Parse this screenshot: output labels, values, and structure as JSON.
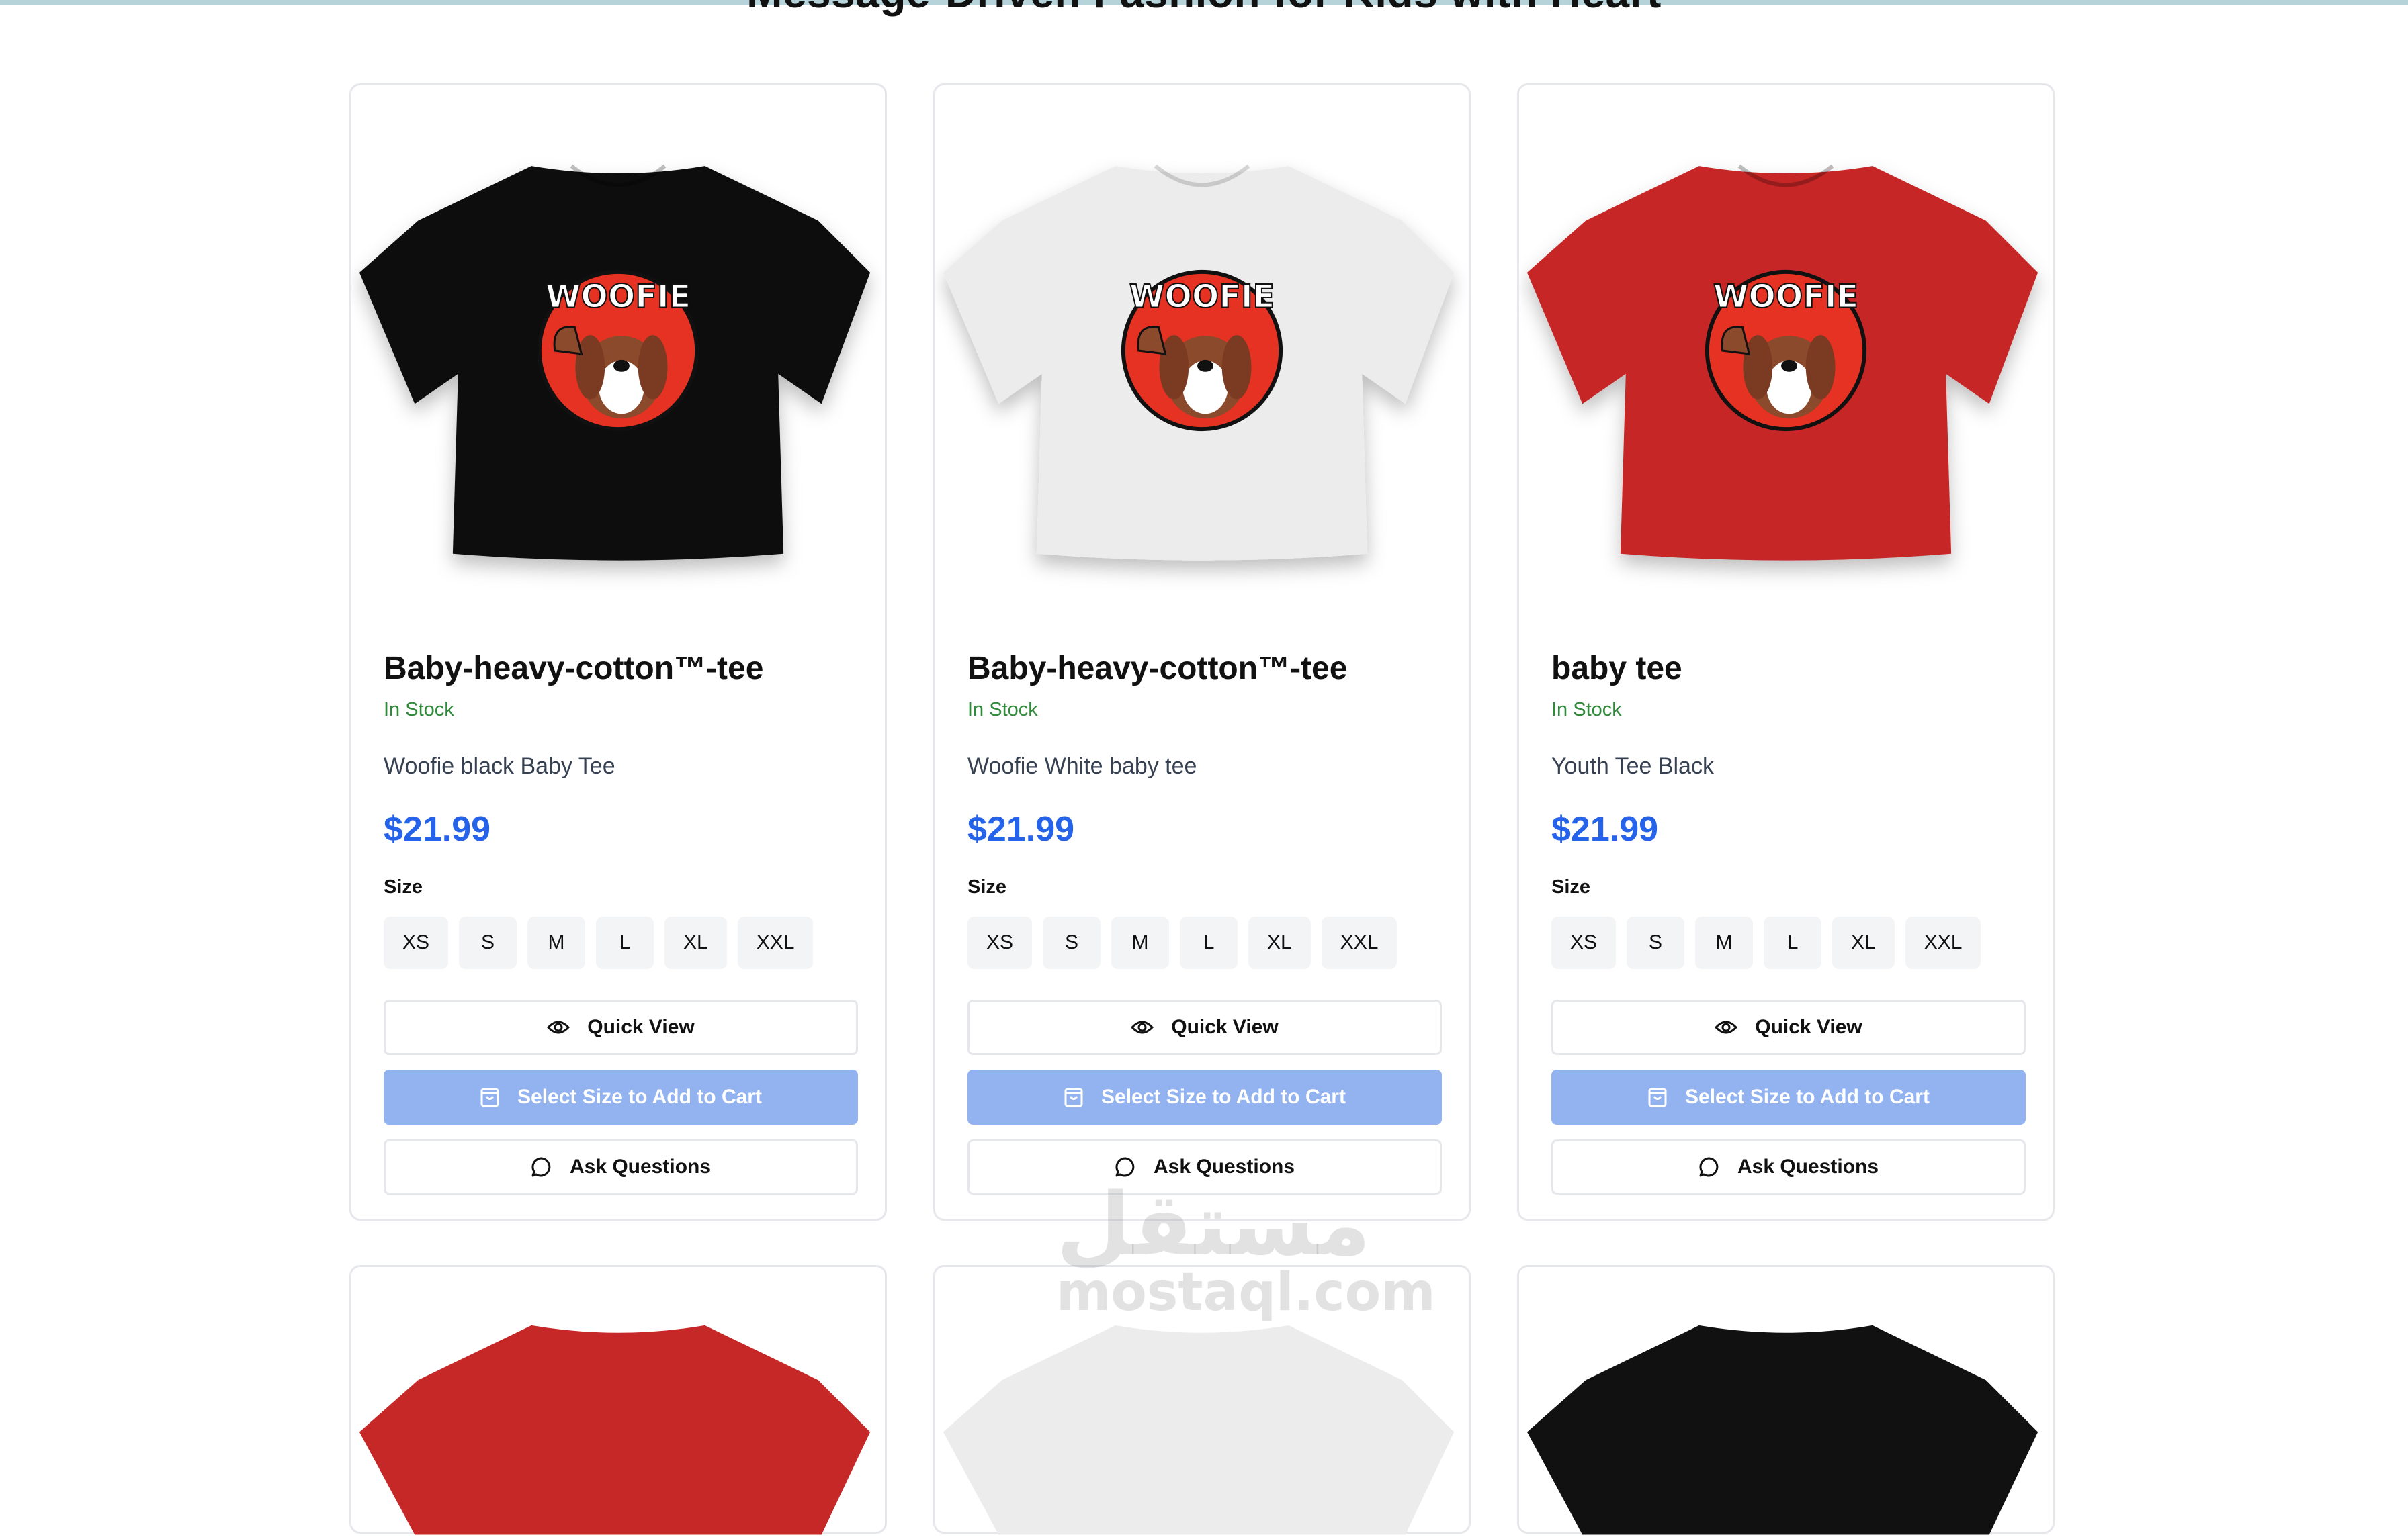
{
  "section": {
    "heading": "Message-Driven Fashion for Kids with Heart"
  },
  "products": [
    {
      "title": "Baby-heavy-cotton™-tee",
      "stock": "In Stock",
      "description": "Woofie black Baby Tee",
      "price": "$21.99",
      "size_label": "Size",
      "sizes": [
        "XS",
        "S",
        "M",
        "L",
        "XL",
        "XXL"
      ],
      "quick_view": "Quick View",
      "add_to_cart": "Select Size to Add to Cart",
      "ask": "Ask Questions",
      "shirt_color": "#111111",
      "logo_text": "WOOFIE"
    },
    {
      "title": "Baby-heavy-cotton™-tee",
      "stock": "In Stock",
      "description": "Woofie White baby tee",
      "price": "$21.99",
      "size_label": "Size",
      "sizes": [
        "XS",
        "S",
        "M",
        "L",
        "XL",
        "XXL"
      ],
      "quick_view": "Quick View",
      "add_to_cart": "Select Size to Add to Cart",
      "ask": "Ask Questions",
      "shirt_color": "#ececec",
      "logo_text": "WOOFIE"
    },
    {
      "title": "baby tee",
      "stock": "In Stock",
      "description": "Youth Tee Black",
      "price": "$21.99",
      "size_label": "Size",
      "sizes": [
        "XS",
        "S",
        "M",
        "L",
        "XL",
        "XXL"
      ],
      "quick_view": "Quick View",
      "add_to_cart": "Select Size to Add to Cart",
      "ask": "Ask Questions",
      "shirt_color": "#c62828",
      "logo_text": "WOOFIE"
    }
  ],
  "second_row_shirt_colors": [
    "#c62828",
    "#ececec",
    "#111111"
  ],
  "watermark": {
    "arabic": "مستقل",
    "latin": "mostaql.com"
  },
  "colors": {
    "price": "#2563eb",
    "in_stock": "#2f8a3a",
    "cart_button": "#93b3f0"
  }
}
